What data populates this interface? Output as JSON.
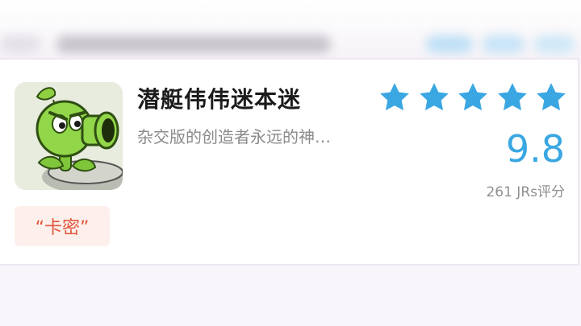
{
  "card": {
    "title": "潜艇伟伟迷本迷",
    "subtitle": "杂交版的创造者永远的神…",
    "score": "9.8",
    "rating_count": "261 JRs评分",
    "tag": "“卡密”",
    "stars_filled": 5,
    "stars_total": 5,
    "avatar_icon": "peashooter-avatar-icon"
  },
  "colors": {
    "accent_blue": "#3aa7e2",
    "tag_text": "#e0553a",
    "tag_bg": "#fdf0ec"
  }
}
